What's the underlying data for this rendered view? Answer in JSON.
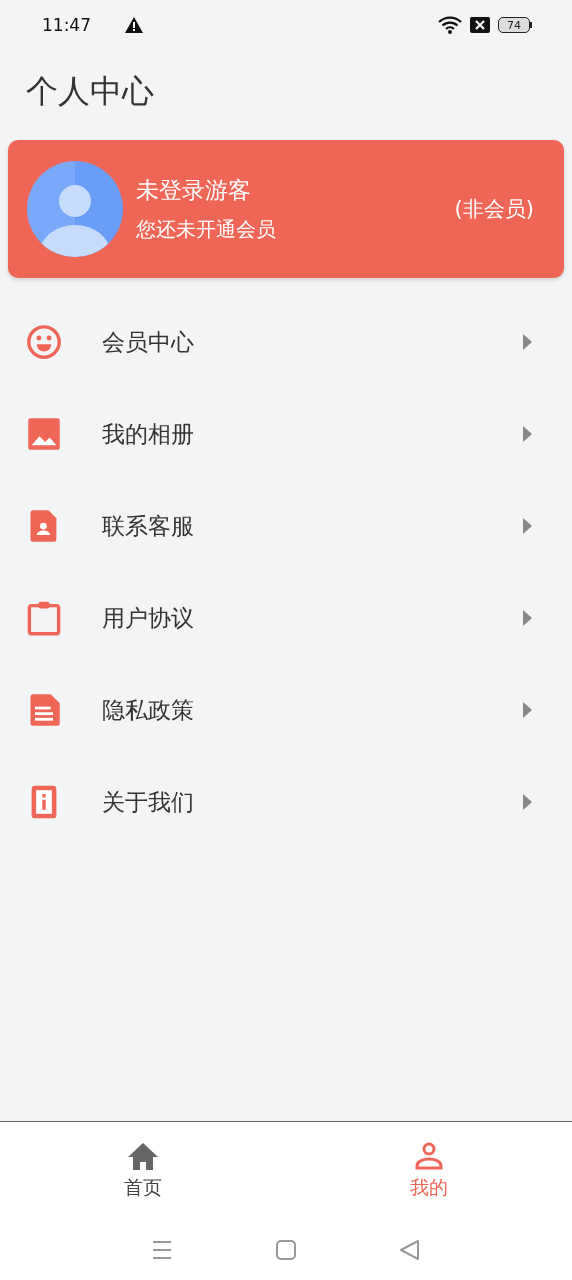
{
  "status_bar": {
    "time": "11:47",
    "battery": "74"
  },
  "title": "个人中心",
  "profile": {
    "name": "未登录游客",
    "subtitle": "您还未开通会员",
    "badge": "(非会员)"
  },
  "menu": [
    {
      "kind": "smile",
      "label": "会员中心"
    },
    {
      "kind": "image",
      "label": "我的相册"
    },
    {
      "kind": "contact",
      "label": "联系客服"
    },
    {
      "kind": "clipboard",
      "label": "用户协议"
    },
    {
      "kind": "document",
      "label": "隐私政策"
    },
    {
      "kind": "info",
      "label": "关于我们"
    }
  ],
  "tabs": [
    {
      "kind": "home",
      "label": "首页",
      "selected": false
    },
    {
      "kind": "person",
      "label": "我的",
      "selected": true
    }
  ]
}
